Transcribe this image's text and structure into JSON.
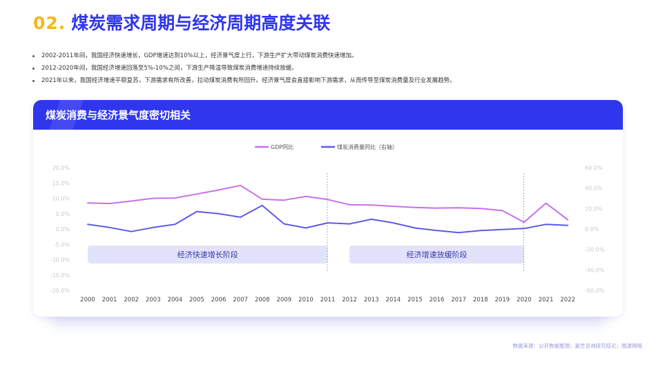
{
  "page": {
    "title_number": "02.",
    "title_text": "煤炭需求周期与经济周期高度关联",
    "bullets": [
      "2002-2011年间，我国经济快速增长，GDP增速达到10%以上，经济景气度上行，下游生产扩大带动煤炭消费快速增加。",
      "2012-2020年间，我国经济增速回落至5%-10%之间，下游生产降温导致煤炭消费增速持续放缓。",
      "2021年以来，我国经济增速平稳复苏，下游需求有所改善，拉动煤炭消费有所回升。经济景气度会直接影响下游需求，从而传导至煤炭消费量及行业发展趋势。"
    ],
    "panel_title": "煤炭消费与经济景气度密切相关",
    "source": "数据来源：公开数据整理；嘉世咨询研究结论；图源网络"
  },
  "colors": {
    "brand_blue": "#2f36ee",
    "accent_yellow": "#f7b51c",
    "gdp_line": "#c76ef0",
    "coal_line": "#5a5ae6",
    "phase_band": "#e2e2fa",
    "phase_text": "#3a3aa8"
  },
  "chart_data": {
    "type": "line",
    "categories": [
      "2000",
      "2001",
      "2002",
      "2003",
      "2004",
      "2005",
      "2006",
      "2007",
      "2008",
      "2009",
      "2010",
      "2011",
      "2012",
      "2013",
      "2014",
      "2015",
      "2016",
      "2017",
      "2018",
      "2019",
      "2020",
      "2021",
      "2022"
    ],
    "series": [
      {
        "name": "GDP同比",
        "axis": "left",
        "values": [
          8.5,
          8.3,
          9.1,
          10.0,
          10.1,
          11.4,
          12.7,
          14.2,
          9.7,
          9.4,
          10.6,
          9.6,
          7.9,
          7.8,
          7.4,
          7.0,
          6.8,
          6.9,
          6.7,
          6.0,
          2.2,
          8.4,
          3.0
        ]
      },
      {
        "name": "煤炭消费量同比（右轴）",
        "axis": "right",
        "values": [
          4.5,
          1.5,
          -2.5,
          1.5,
          4.5,
          17.0,
          15.0,
          11.5,
          23.0,
          5.0,
          1.0,
          6.0,
          5.0,
          9.5,
          6.0,
          1.0,
          -1.5,
          -3.5,
          -1.5,
          -0.5,
          0.5,
          4.5,
          3.5
        ]
      }
    ],
    "y_left": {
      "range": [
        -20,
        20
      ],
      "ticks": [
        "20.0%",
        "15.0%",
        "10.0%",
        "5.0%",
        "0.0%",
        "-5.0%",
        "-10.0%",
        "-15.0%",
        "-20.0%"
      ]
    },
    "y_right": {
      "range": [
        -60,
        60
      ],
      "ticks": [
        "60.0%",
        "40.0%",
        "20.0%",
        "0.0%",
        "-20.0%",
        "-40.0%",
        "-60.0%"
      ]
    },
    "phases": [
      {
        "label": "经济快速增长阶段",
        "from": "2000",
        "to": "2011"
      },
      {
        "label": "经济增速放缓阶段",
        "from": "2012",
        "to": "2020"
      }
    ],
    "dividers": [
      "2011",
      "2020"
    ],
    "legend_position": "top-center",
    "grid": false,
    "title": "",
    "xlabel": "",
    "ylabel": ""
  }
}
